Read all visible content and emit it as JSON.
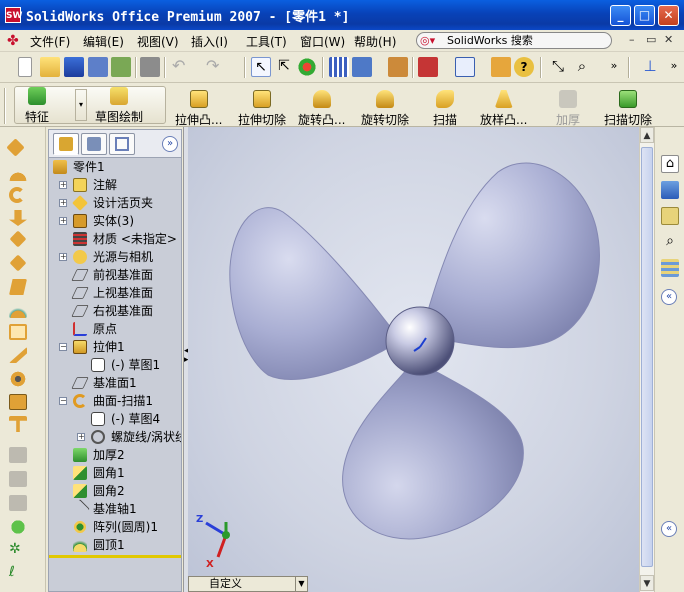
{
  "window": {
    "title": "SolidWorks Office Premium 2007 - [零件1 *]",
    "app_icon": "SW",
    "minimize_label": "_",
    "maximize_label": "□",
    "close_label": "✕"
  },
  "menubar": {
    "items": [
      "文件(F)",
      "编辑(E)",
      "视图(V)",
      "插入(I)",
      "工具(T)",
      "窗口(W)",
      "帮助(H)"
    ],
    "search_placeholder": "SolidWorks 搜索",
    "mdi_minimize": "–",
    "mdi_restore": "▭",
    "mdi_close": "✕"
  },
  "command_manager": {
    "features_label": "特征",
    "sketch_label": "草图绘制",
    "commands": [
      {
        "label": "拉伸凸...",
        "enabled": true
      },
      {
        "label": "拉伸切除",
        "enabled": true
      },
      {
        "label": "旋转凸...",
        "enabled": true
      },
      {
        "label": "旋转切除",
        "enabled": true
      },
      {
        "label": "扫描",
        "enabled": true
      },
      {
        "label": "放样凸...",
        "enabled": true
      },
      {
        "label": "加厚",
        "enabled": false
      },
      {
        "label": "扫描切除",
        "enabled": true
      }
    ]
  },
  "feature_tree": {
    "more_label": "»",
    "items": [
      {
        "label": "零件1",
        "icon": "part-icon",
        "expander": ""
      },
      {
        "label": "注解",
        "icon": "annotation-icon",
        "expander": "+"
      },
      {
        "label": "设计活页夹",
        "icon": "design-binder-icon",
        "expander": "+"
      },
      {
        "label": "实体(3)",
        "icon": "solid-bodies-icon",
        "expander": "+"
      },
      {
        "label": "材质 <未指定>",
        "icon": "material-icon",
        "expander": ""
      },
      {
        "label": "光源与相机",
        "icon": "lights-cameras-icon",
        "expander": "+"
      },
      {
        "label": "前视基准面",
        "icon": "plane-icon",
        "expander": ""
      },
      {
        "label": "上视基准面",
        "icon": "plane-icon",
        "expander": ""
      },
      {
        "label": "右视基准面",
        "icon": "plane-icon",
        "expander": ""
      },
      {
        "label": "原点",
        "icon": "origin-icon",
        "expander": ""
      },
      {
        "label": "拉伸1",
        "icon": "extrude-icon",
        "expander": "−"
      },
      {
        "label": "(-) 草图1",
        "icon": "sketch-icon",
        "expander": ""
      },
      {
        "label": "基准面1",
        "icon": "plane-icon",
        "expander": ""
      },
      {
        "label": "曲面-扫描1",
        "icon": "surface-sweep-icon",
        "expander": "−"
      },
      {
        "label": "(-) 草图4",
        "icon": "sketch-icon",
        "expander": ""
      },
      {
        "label": "螺旋线/涡状线1",
        "icon": "helix-icon",
        "expander": "+"
      },
      {
        "label": "加厚2",
        "icon": "thicken-icon",
        "expander": ""
      },
      {
        "label": "圆角1",
        "icon": "fillet-icon",
        "expander": ""
      },
      {
        "label": "圆角2",
        "icon": "fillet-icon",
        "expander": ""
      },
      {
        "label": "基准轴1",
        "icon": "axis-icon",
        "expander": ""
      },
      {
        "label": "阵列(圆周)1",
        "icon": "circular-pattern-icon",
        "expander": ""
      },
      {
        "label": "圆顶1",
        "icon": "dome-icon",
        "expander": ""
      }
    ]
  },
  "viewport": {
    "view_orientation": "自定义",
    "triad": {
      "x": "X",
      "y": "Y",
      "z": "Z"
    }
  },
  "colors": {
    "titlebar": "#0842b8",
    "tree_background": "#c9cdd7",
    "viewport": "#cfd4e2",
    "propeller": "#9ea3c8",
    "rollback_bar": "#e1c800"
  }
}
